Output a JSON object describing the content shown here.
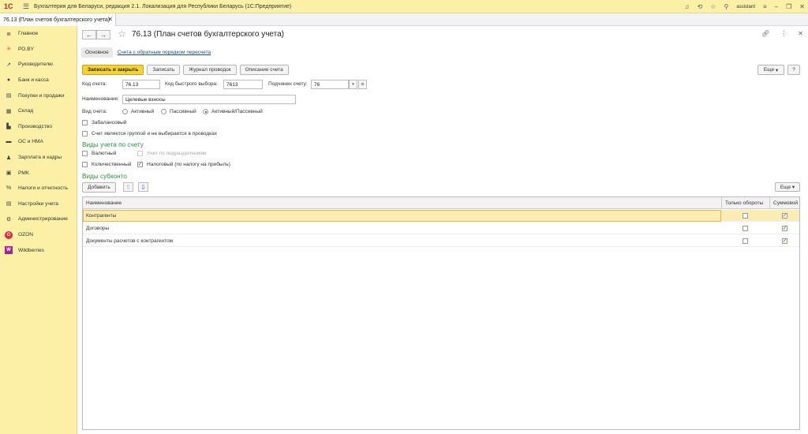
{
  "titlebar": {
    "logo": "1С",
    "title": "Бухгалтерия для Беларуси, редакция 2.1. Локализация для Республики Беларусь   (1С:Предприятие)",
    "user": "assistant"
  },
  "tab": {
    "label": "76.13 (План счетов бухгалтерского учета)"
  },
  "sidebar": {
    "items": [
      {
        "label": "Главное",
        "icon": "menu-icon",
        "glyph": "≣"
      },
      {
        "label": "РО.BY",
        "icon": "ro-by-icon",
        "glyph": "✳"
      },
      {
        "label": "Руководителю",
        "icon": "chart-trend-icon",
        "glyph": "↗"
      },
      {
        "label": "Банк и касса",
        "icon": "bank-icon",
        "glyph": "●"
      },
      {
        "label": "Покупки и продажи",
        "icon": "cart-icon",
        "glyph": "▤"
      },
      {
        "label": "Склад",
        "icon": "warehouse-icon",
        "glyph": "▦"
      },
      {
        "label": "Производство",
        "icon": "factory-icon",
        "glyph": "▙"
      },
      {
        "label": "ОС и НМА",
        "icon": "assets-icon",
        "glyph": "▬"
      },
      {
        "label": "Зарплата и кадры",
        "icon": "person-icon",
        "glyph": "♟"
      },
      {
        "label": "РМК",
        "icon": "cash-register-icon",
        "glyph": "▣"
      },
      {
        "label": "Налоги и отчетность",
        "icon": "taxes-icon",
        "glyph": "%"
      },
      {
        "label": "Настройки учета",
        "icon": "settings-list-icon",
        "glyph": "▤"
      },
      {
        "label": "Администрирование",
        "icon": "gear-icon",
        "glyph": "⚙"
      },
      {
        "label": "OZON",
        "icon": "ozon-icon",
        "glyph": "O"
      },
      {
        "label": "Wildberries",
        "icon": "wildberries-icon",
        "glyph": "W"
      }
    ]
  },
  "page": {
    "title": "76.13 (План счетов бухгалтерского учета)"
  },
  "subtabs": {
    "active": "Основное",
    "link": "Счета с обратным порядком пересчета"
  },
  "toolbar": {
    "save_close": "Записать и закрыть",
    "save": "Записать",
    "journal": "Журнал проводок",
    "description": "Описание счета",
    "more": "Еще",
    "help": "?"
  },
  "form": {
    "code_label": "Код счета:",
    "code_value": "76.13",
    "quick_label": "Код быстрого выбора:",
    "quick_value": "7613",
    "parent_label": "Подчинен счету:",
    "parent_value": "76",
    "name_label": "Наименование:",
    "name_value": "Целевые взносы",
    "type_label": "Вид счета:",
    "type_options": [
      "Активный",
      "Пассивный",
      "Активный/Пассивный"
    ],
    "type_selected": "Активный/Пассивный",
    "offbalance": "Забалансовый",
    "group": "Счет является группой и не выбирается в проводках"
  },
  "accounting": {
    "title": "Виды учета по счету",
    "currency": "Валютный",
    "by_division": "Учет по подразделениям",
    "quantity": "Количественный",
    "tax": "Налоговый (по налогу на прибыль)"
  },
  "subconto": {
    "title": "Виды субконто",
    "add": "Добавить",
    "more": "Еще",
    "columns": [
      "Наименование",
      "Только обороты",
      "Суммовой"
    ],
    "rows": [
      {
        "name": "Контрагенты",
        "turnover_only": false,
        "sum": true
      },
      {
        "name": "Договоры",
        "turnover_only": false,
        "sum": true
      },
      {
        "name": "Документы расчетов с контрагентом",
        "turnover_only": false,
        "sum": true
      }
    ]
  }
}
